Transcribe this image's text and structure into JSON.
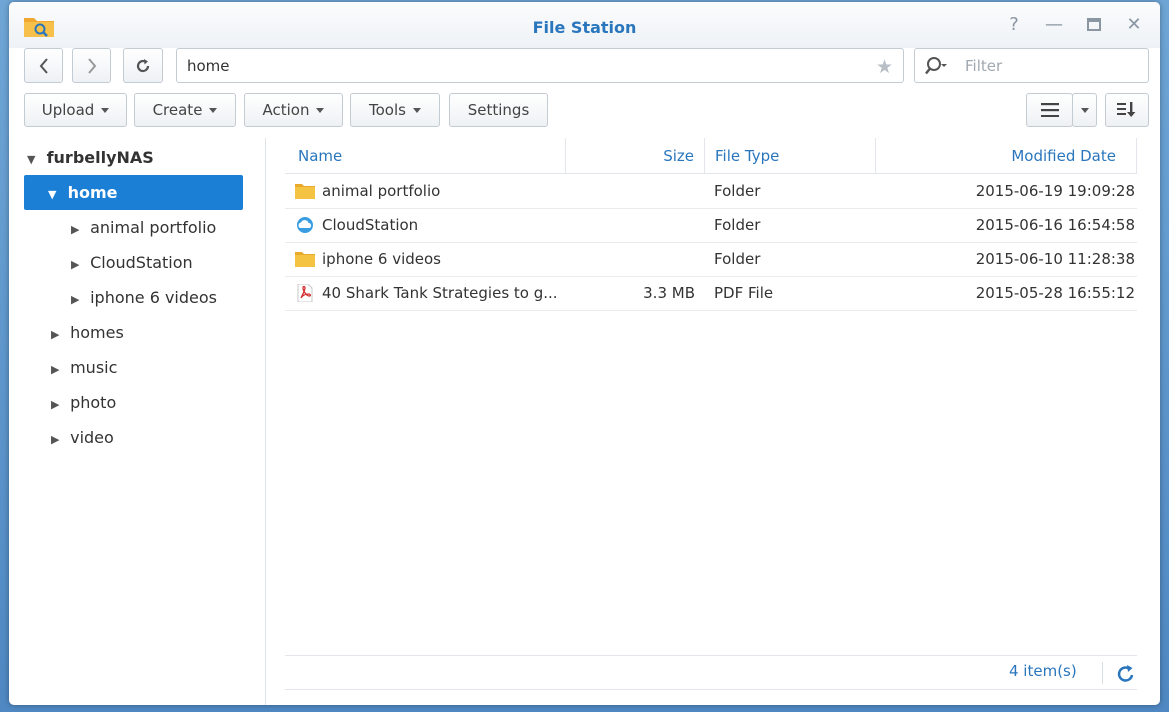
{
  "window": {
    "title": "File Station"
  },
  "nav": {
    "path": "home",
    "filter_placeholder": "Filter"
  },
  "toolbar": {
    "upload": "Upload",
    "create": "Create",
    "action": "Action",
    "tools": "Tools",
    "settings": "Settings"
  },
  "tree": {
    "root": "furbellyNAS",
    "items": [
      {
        "label": "home",
        "level": 1,
        "expanded": true,
        "selected": true
      },
      {
        "label": "animal portfolio",
        "level": 2
      },
      {
        "label": "CloudStation",
        "level": 2
      },
      {
        "label": "iphone 6 videos",
        "level": 2
      },
      {
        "label": "homes",
        "level": 1
      },
      {
        "label": "music",
        "level": 1
      },
      {
        "label": "photo",
        "level": 1
      },
      {
        "label": "video",
        "level": 1
      }
    ]
  },
  "list": {
    "columns": {
      "name": "Name",
      "size": "Size",
      "type": "File Type",
      "modified": "Modified Date"
    },
    "rows": [
      {
        "name": "animal portfolio",
        "size": "",
        "type": "Folder",
        "modified": "2015-06-19 19:09:28",
        "icon": "folder-icon"
      },
      {
        "name": "CloudStation",
        "size": "",
        "type": "Folder",
        "modified": "2015-06-16 16:54:58",
        "icon": "cloud-folder-icon"
      },
      {
        "name": "iphone 6 videos",
        "size": "",
        "type": "Folder",
        "modified": "2015-06-10 11:28:38",
        "icon": "folder-icon"
      },
      {
        "name": "40 Shark Tank Strategies to g...",
        "size": "3.3 MB",
        "type": "PDF File",
        "modified": "2015-05-28 16:55:12",
        "icon": "pdf-icon"
      }
    ]
  },
  "footer": {
    "count": "4 item(s)"
  },
  "colors": {
    "accent": "#2a76bd",
    "selected": "#1b7fd5",
    "folder": "#f5c342"
  }
}
